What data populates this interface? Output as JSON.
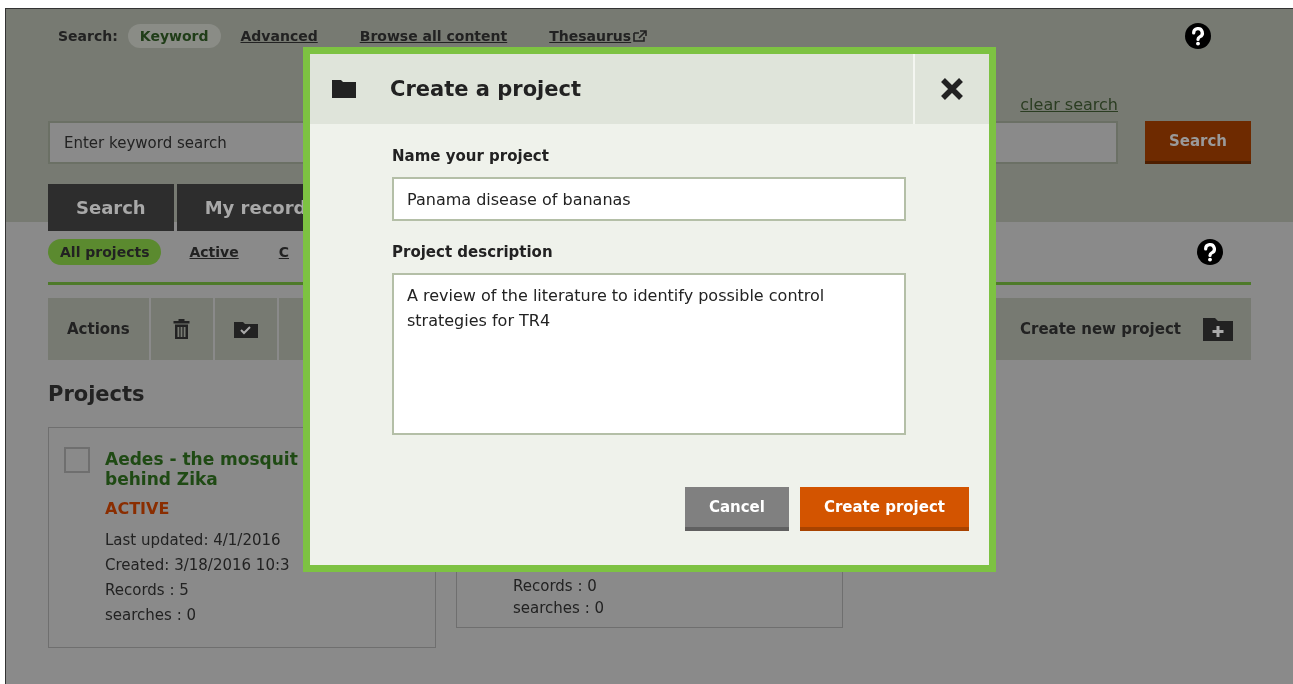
{
  "search_bar": {
    "label": "Search:",
    "modes": [
      {
        "label": "Keyword",
        "selected": true
      },
      {
        "label": "Advanced",
        "selected": false
      },
      {
        "label": "Browse all content",
        "selected": false
      },
      {
        "label": "Thesaurus",
        "selected": false,
        "external": true
      }
    ],
    "clear_link": "clear search",
    "placeholder": "Enter keyword search",
    "button": "Search"
  },
  "tabs": [
    {
      "label": "Search"
    },
    {
      "label": "My record"
    }
  ],
  "filters": [
    {
      "label": "All projects",
      "selected": true
    },
    {
      "label": "Active",
      "selected": false
    },
    {
      "label": "C",
      "selected": false
    }
  ],
  "actions_bar": {
    "label": "Actions",
    "create": "Create new project"
  },
  "projects_heading": "Projects",
  "projects": [
    {
      "title_lines": [
        "Aedes - the mosquit",
        "behind Zika"
      ],
      "status": "ACTIVE",
      "checked": false,
      "details": [
        "Last updated: 4/1/2016",
        "Created: 3/18/2016 10:3",
        "Records : 5",
        "searches : 0"
      ]
    },
    {
      "details": [
        "Records : 0",
        "searches : 0"
      ]
    }
  ],
  "modal": {
    "title": "Create a project",
    "fields": [
      {
        "kind": "input",
        "label": "Name your project",
        "value": "Panama disease of bananas"
      },
      {
        "kind": "textarea",
        "label": "Project description",
        "value": "A review of the literature to identify possible control strategies for TR4"
      }
    ],
    "buttons": [
      {
        "kind": "secondary",
        "label": "Cancel"
      },
      {
        "kind": "primary",
        "label": "Create project"
      }
    ]
  }
}
